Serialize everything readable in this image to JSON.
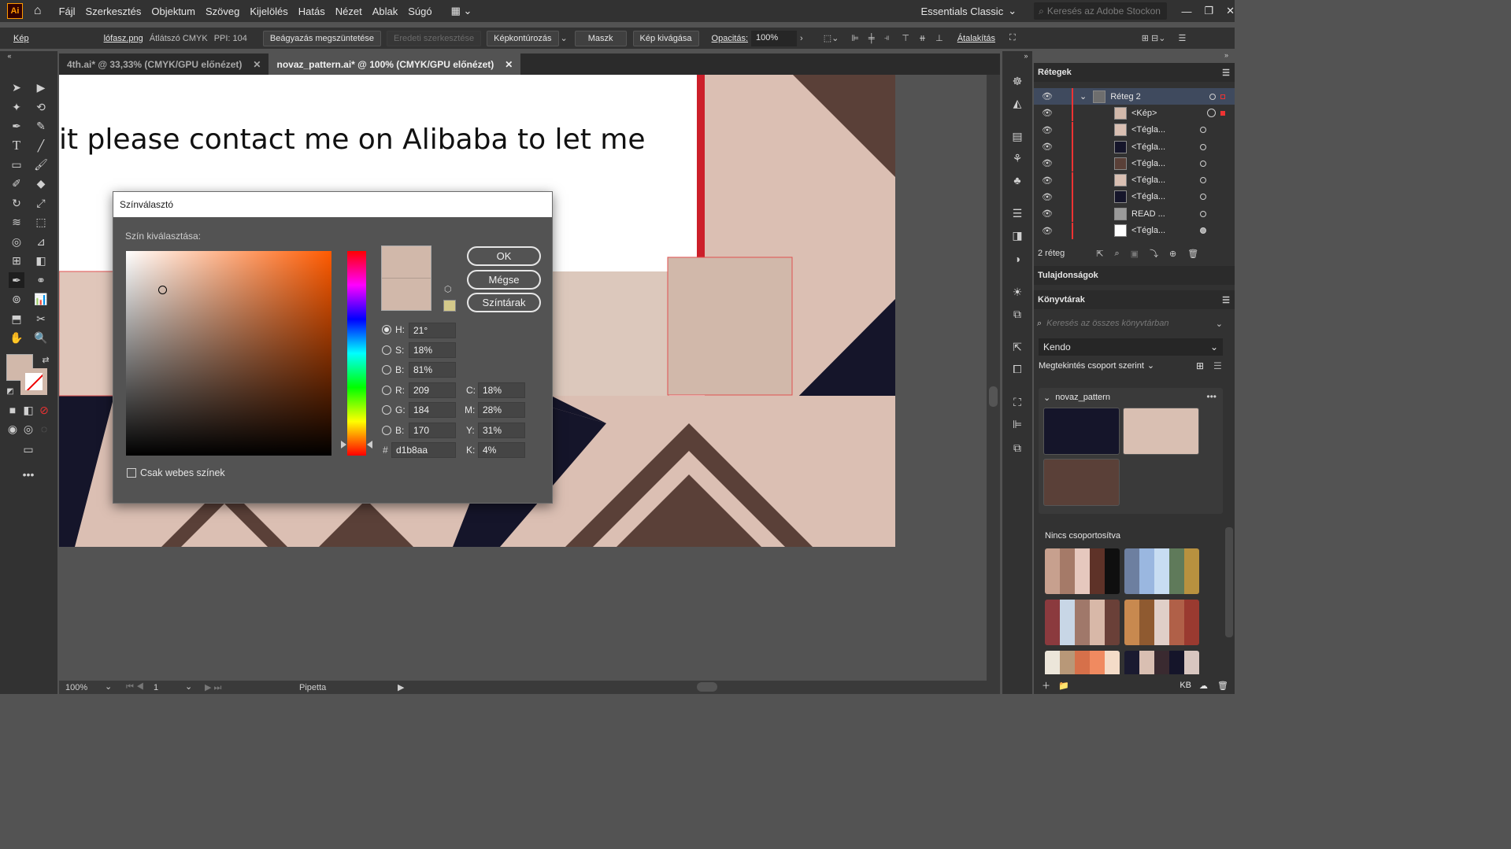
{
  "app": {
    "logo": "Ai",
    "menu": [
      "Fájl",
      "Szerkesztés",
      "Objektum",
      "Szöveg",
      "Kijelölés",
      "Hatás",
      "Nézet",
      "Ablak",
      "Súgó"
    ],
    "workspace": "Essentials Classic",
    "stock_search_placeholder": "Keresés az Adobe Stockon"
  },
  "control_bar": {
    "selection_type": "Kép",
    "file_link": "lófasz.png",
    "color_mode": "Átlátszó CMYK",
    "ppi": "PPI: 104",
    "unembed": "Beágyazás megszüntetése",
    "edit_original": "Eredeti szerkesztése",
    "image_trace": "Képkontúrozás",
    "mask": "Maszk",
    "crop": "Kép kivágása",
    "opacity_label": "Opacitás:",
    "opacity_value": "100%",
    "transform": "Átalakítás"
  },
  "tabs": [
    {
      "label": "4th.ai* @ 33,33% (CMYK/GPU előnézet)"
    },
    {
      "label": "novaz_pattern.ai* @ 100% (CMYK/GPU előnézet)"
    }
  ],
  "canvas_text": "it please contact me on Alibaba to let me",
  "status": {
    "zoom": "100%",
    "artboard": "1",
    "tool": "Pipetta"
  },
  "layers_panel": {
    "title": "Rétegek",
    "layers": [
      {
        "name": "Réteg 2",
        "thumb": "#6e6e6e"
      },
      {
        "name": "<Kép>",
        "thumb": "#d1b8aa"
      },
      {
        "name": "<Tégla...",
        "thumb": "#d9bfb2"
      },
      {
        "name": "<Tégla...",
        "thumb": "#15152a"
      },
      {
        "name": "<Tégla...",
        "thumb": "#5a4038"
      },
      {
        "name": "<Tégla...",
        "thumb": "#d9bfb2"
      },
      {
        "name": "<Tégla...",
        "thumb": "#15152a"
      },
      {
        "name": "READ ...",
        "thumb": "#9a9a9a"
      },
      {
        "name": "<Tégla...",
        "thumb": "#ffffff"
      }
    ],
    "count": "2 réteg"
  },
  "properties_title": "Tulajdonságok",
  "libraries": {
    "title": "Könyvtárak",
    "search_placeholder": "Keresés az összes könyvtárban",
    "library": "Kendo",
    "group_by": "Megtekintés csoport szerint",
    "group_name": "novaz_pattern",
    "ungrouped": "Nincs csoportosítva",
    "size_unit": "KB",
    "swatches": [
      "#15152a",
      "#d9bfb2",
      "#5a4038"
    ],
    "themes": [
      [
        "#c7a08e",
        "#a57a68",
        "#e6c8be",
        "#5e3228",
        "#0f0f0f"
      ],
      [
        "#6d7fa0",
        "#9ab7e0",
        "#c8ddf2",
        "#5f7a5a",
        "#b8913f"
      ],
      [
        "#8b3a3e",
        "#c8d6e6",
        "#a0786a",
        "#d8b8a8",
        "#6a4038"
      ],
      [
        "#c8894f",
        "#8f5a30",
        "#e0cfc8",
        "#b06048",
        "#9a3a30"
      ],
      [
        "#ece6da",
        "#b89878",
        "#d6704a",
        "#f08a60",
        "#f4dcc8"
      ],
      [
        "#1a1a30",
        "#d9bfb2",
        "#3a2a30",
        "#15152a",
        "#d8c6c0"
      ]
    ]
  },
  "color_picker": {
    "title": "Színválasztó",
    "choose_label": "Szín kiválasztása:",
    "ok": "OK",
    "cancel": "Mégse",
    "swatches_btn": "Színtárak",
    "fields": {
      "H": "21°",
      "S": "18%",
      "B": "81%",
      "R": "209",
      "G": "184",
      "B2": "170",
      "hex": "d1b8aa",
      "C": "18%",
      "M": "28%",
      "Y": "31%",
      "K": "4%"
    },
    "labels": {
      "H": "H:",
      "S": "S:",
      "B": "B:",
      "R": "R:",
      "G": "G:",
      "B2": "B:",
      "hex": "#",
      "C": "C:",
      "M": "M:",
      "Y": "Y:",
      "K": "K:"
    },
    "web_only": "Csak webes színek",
    "current_color": "#d1b8aa",
    "hue_color": "#ff5a00"
  }
}
